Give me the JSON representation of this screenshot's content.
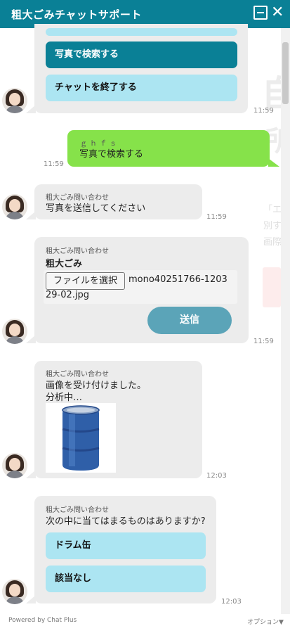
{
  "header": {
    "title": "粗大ごみチャットサポート"
  },
  "background": {
    "glyph1": "自",
    "glyph2": "所",
    "line1": "「エ",
    "line2": "別す",
    "line3": "画際"
  },
  "conversation": {
    "first": {
      "option_search_photo": "写真で検索する",
      "option_end_chat": "チャットを終了する",
      "time": "11:59"
    },
    "user": {
      "name": "ｇｈｆｓ",
      "text": "写真で検索する",
      "time": "11:59"
    },
    "msg_send_photo": {
      "sender": "粗大ごみ問い合わせ",
      "text": "写真を送信してください",
      "time": "11:59"
    },
    "upload": {
      "sender": "粗大ごみ問い合わせ",
      "label": "粗大ごみ",
      "file_button": "ファイルを選択",
      "file_name_line1": "mono40251766-1203",
      "file_name_line2": "29-02.jpg",
      "send_button": "送信",
      "time": "11:59"
    },
    "analysis": {
      "sender": "粗大ごみ問い合わせ",
      "line1": "画像を受け付けました。",
      "line2": "分析中…",
      "time": "12:03"
    },
    "question": {
      "sender": "粗大ごみ問い合わせ",
      "text": "次の中に当てはまるものはありますか?",
      "option1": "ドラム缶",
      "option2": "該当なし",
      "time": "12:03"
    }
  },
  "footer": {
    "powered_by": "Powered by Chat Plus",
    "options": "オプション▼"
  },
  "colors": {
    "header": "#0a8096",
    "user_bubble": "#86e24a",
    "option": "#ace5f2",
    "send_button": "#5ba4b8"
  }
}
